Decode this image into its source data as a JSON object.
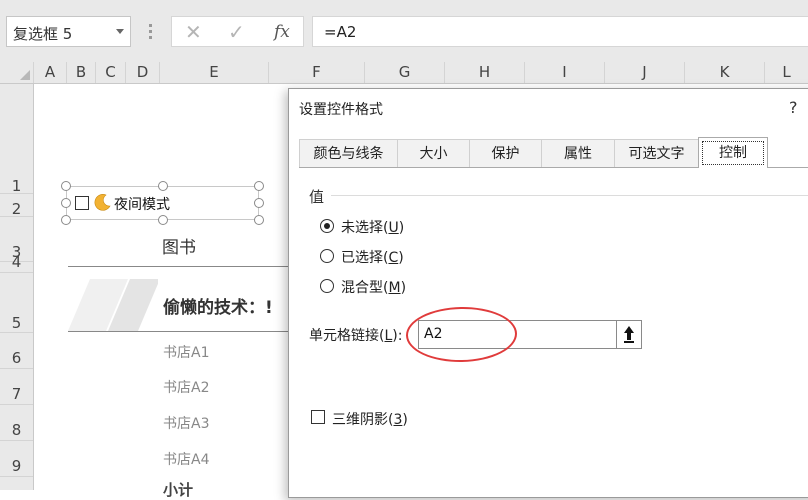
{
  "formula_bar": {
    "name_box": "复选框 5",
    "cancel_symbol": "✕",
    "enter_symbol": "✓",
    "fx_label": "fx",
    "formula": "=A2"
  },
  "columns": [
    "A",
    "B",
    "C",
    "D",
    "E",
    "F",
    "G",
    "H",
    "I",
    "J",
    "K",
    "L"
  ],
  "rows": [
    "1",
    "2",
    "3",
    "4",
    "5",
    "6",
    "7",
    "8",
    "9"
  ],
  "sheet": {
    "checkbox_label": "夜间模式",
    "book_title": "图书",
    "bold_title": "偷懒的技术：!",
    "stores": [
      "书店A1",
      "书店A2",
      "书店A3",
      "书店A4"
    ],
    "partial_text": "小计"
  },
  "dialog": {
    "title": "设置控件格式",
    "help": "?",
    "tabs": [
      "颜色与线条",
      "大小",
      "保护",
      "属性",
      "可选文字",
      "控制"
    ],
    "active_tab": "控制",
    "group_label": "值",
    "options": [
      {
        "text": "未选择(",
        "key": "U",
        "end": ")",
        "selected": true
      },
      {
        "text": "已选择(",
        "key": "C",
        "end": ")",
        "selected": false
      },
      {
        "text": "混合型(",
        "key": "M",
        "end": ")",
        "selected": false
      }
    ],
    "cell_link_label": "单元格链接(",
    "cell_link_key": "L",
    "cell_link_end": "):",
    "cell_link_value": "A2",
    "shading_label": "三维阴影(",
    "shading_key": "3",
    "shading_end": ")",
    "shading_checked": false
  },
  "colors": {
    "ribbon_gray": "#e9e9e9",
    "annotation_red": "#e03b3b"
  }
}
